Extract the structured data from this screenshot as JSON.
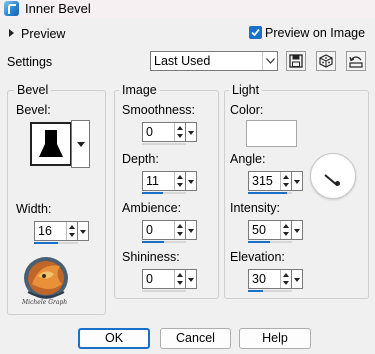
{
  "window": {
    "title": "Inner Bevel"
  },
  "top": {
    "preview_label": "Preview",
    "preview_on_image_label": "Preview on Image",
    "preview_on_image_checked": true,
    "settings_label": "Settings",
    "preset_value": "Last Used"
  },
  "bevel_group": {
    "title": "Bevel",
    "bevel_label": "Bevel:",
    "width_label": "Width:",
    "width_value": "16",
    "width_fraction": 0.55,
    "logo_text": "Michele Graph"
  },
  "image_group": {
    "title": "Image",
    "smoothness_label": "Smoothness:",
    "smoothness_value": "0",
    "smoothness_fraction": 0.0,
    "depth_label": "Depth:",
    "depth_value": "11",
    "depth_fraction": 0.48,
    "ambience_label": "Ambience:",
    "ambience_value": "0",
    "ambience_fraction": 0.5,
    "shininess_label": "Shininess:",
    "shininess_value": "0",
    "shininess_fraction": 0.0
  },
  "light_group": {
    "title": "Light",
    "color_label": "Color:",
    "color_value": "#ffffff",
    "angle_label": "Angle:",
    "angle_value": "315",
    "angle_fraction": 0.88,
    "intensity_label": "Intensity:",
    "intensity_value": "50",
    "intensity_fraction": 0.5,
    "elevation_label": "Elevation:",
    "elevation_value": "30",
    "elevation_fraction": 0.33
  },
  "buttons": {
    "ok": "OK",
    "cancel": "Cancel",
    "help": "Help"
  },
  "colors": {
    "accent": "#1a6fc9",
    "background": "#f0f0f0",
    "titlebar": "#f7f0f2"
  },
  "icons": [
    "app-icon",
    "expand-triangle-icon",
    "checkbox-checked-icon",
    "chevron-down-icon",
    "save-disk-icon",
    "random-dice-icon",
    "reset-icon",
    "angle-dial-icon"
  ]
}
